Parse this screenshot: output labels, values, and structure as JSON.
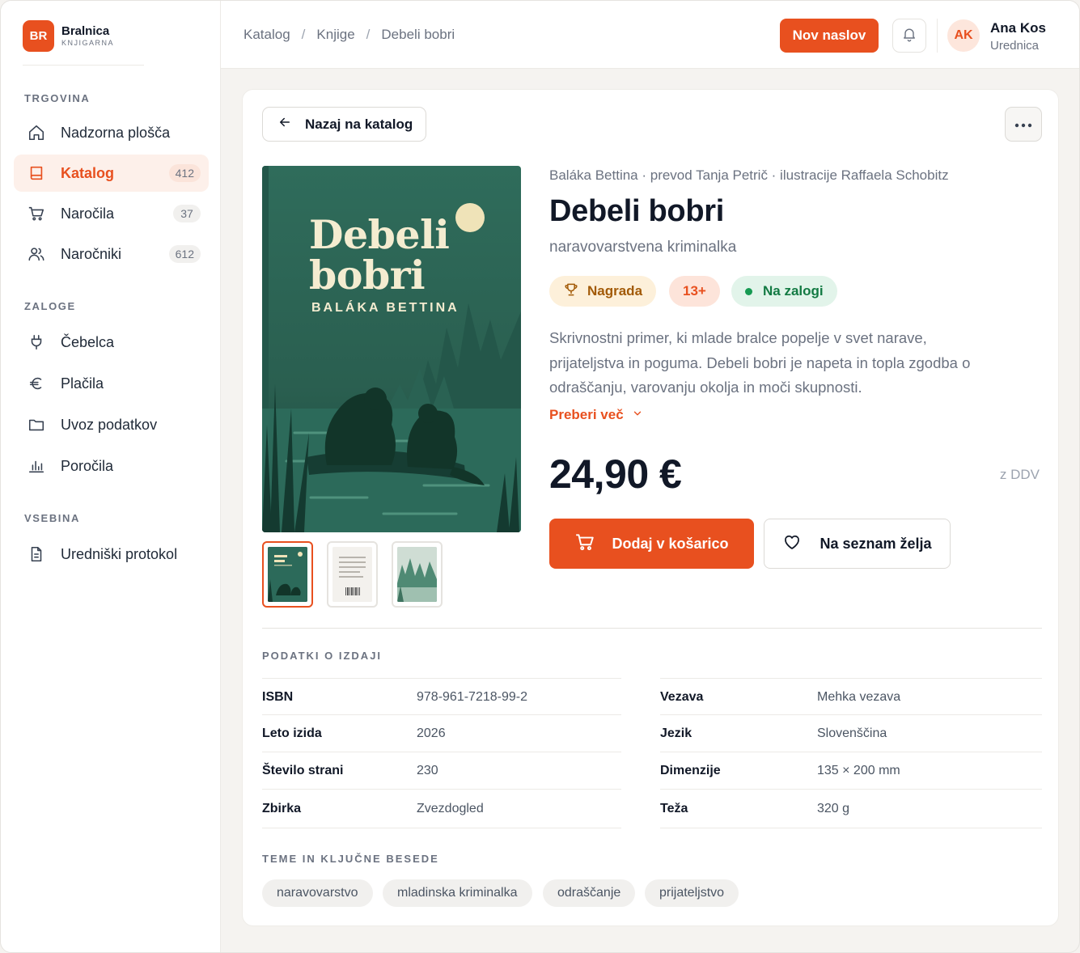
{
  "brand": {
    "initials": "BR",
    "name": "Bralnica",
    "subtitle": "KNJIGARNA"
  },
  "sidebar": {
    "sections": [
      {
        "title": "TRGOVINA"
      },
      {
        "title": "ZALOGE"
      },
      {
        "title": "VSEBINA"
      }
    ],
    "items": [
      {
        "label": "Nadzorna plošča",
        "icon": "home-icon"
      },
      {
        "label": "Katalog",
        "icon": "book-icon",
        "badge": "412",
        "active": true
      },
      {
        "label": "Naročila",
        "icon": "cart-icon",
        "badge": "37"
      },
      {
        "label": "Naročniki",
        "icon": "users-icon",
        "badge": "612"
      },
      {
        "label": "Čebelca",
        "icon": "plug-icon"
      },
      {
        "label": "Plačila",
        "icon": "euro-icon"
      },
      {
        "label": "Uvoz podatkov",
        "icon": "folder-icon"
      },
      {
        "label": "Poročila",
        "icon": "bar-chart-icon"
      },
      {
        "label": "Uredniški protokol",
        "icon": "document-icon"
      }
    ]
  },
  "header": {
    "breadcrumb": [
      "Katalog",
      "Knjige",
      "Debeli bobri"
    ],
    "separator": "/",
    "new_title_label": "Nov naslov",
    "user": {
      "initials": "AK",
      "name": "Ana Kos",
      "role": "Urednica"
    }
  },
  "book": {
    "back_label": "Nazaj na katalog",
    "cover_title_line1": "Debeli",
    "cover_title_line2": "bobri",
    "cover_author": "BALÁKA BETTINA",
    "credits": "Baláka Bettina · prevod Tanja Petrič · ilustracije Raffaela Schobitz",
    "title": "Debeli bobri",
    "genre": "naravovarstvena kriminalka",
    "badges": {
      "award": "Nagrada",
      "age": "13+",
      "stock": "Na zalogi"
    },
    "description": "Skrivnostni primer, ki mlade bralce popelje v svet narave, prijateljstva in poguma. Debeli bobri je napeta in topla zgodba o odraščanju, varovanju okolja in moči skupnosti.",
    "read_more": "Preberi več",
    "price": "24,90 €",
    "vat_note": "z DDV",
    "add_to_cart": "Dodaj v košarico",
    "wishlist": "Na seznam želja"
  },
  "specs": {
    "title": "PODATKI O IZDAJI",
    "left": [
      {
        "key": "ISBN",
        "value": "978-961-7218-99-2"
      },
      {
        "key": "Leto izida",
        "value": "2026"
      },
      {
        "key": "Število strani",
        "value": "230"
      },
      {
        "key": "Zbirka",
        "value": "Zvezdogled"
      }
    ],
    "right": [
      {
        "key": "Vezava",
        "value": "Mehka vezava"
      },
      {
        "key": "Jezik",
        "value": "Slovenščina"
      },
      {
        "key": "Dimenzije",
        "value": "135 × 200 mm"
      },
      {
        "key": "Teža",
        "value": "320 g"
      }
    ]
  },
  "topics": {
    "title": "TEME IN KLJUČNE BESEDE",
    "tags": [
      "naravovarstvo",
      "mladinska kriminalka",
      "odraščanje",
      "prijateljstvo"
    ]
  },
  "colors": {
    "accent": "#e8501f",
    "cover_green": "#2d6a58",
    "success": "#169a52"
  }
}
